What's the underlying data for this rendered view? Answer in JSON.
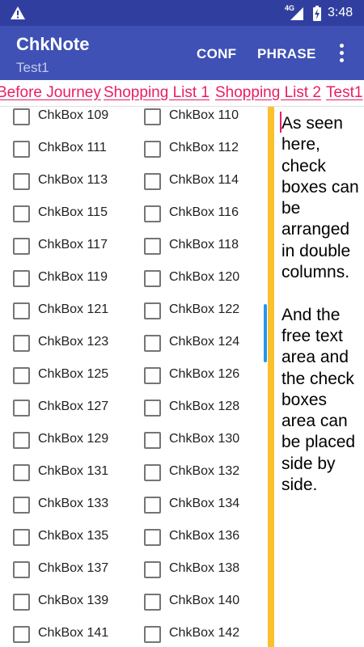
{
  "status_bar": {
    "network": "4G",
    "time": "3:48",
    "icons": [
      "warning-icon",
      "signal-icon",
      "battery-icon"
    ]
  },
  "app_bar": {
    "title": "ChkNote",
    "subtitle": "Test1",
    "actions": [
      "CONF",
      "PHRASE"
    ],
    "overflow_icon": "more-vert-icon"
  },
  "tabs": [
    "Before Journey",
    "Shopping List 1",
    "Shopping List 2",
    "Test1"
  ],
  "checkboxes": [
    "ChkBox 109",
    "ChkBox 110",
    "ChkBox 111",
    "ChkBox 112",
    "ChkBox 113",
    "ChkBox 114",
    "ChkBox 115",
    "ChkBox 116",
    "ChkBox 117",
    "ChkBox 118",
    "ChkBox 119",
    "ChkBox 120",
    "ChkBox 121",
    "ChkBox 122",
    "ChkBox 123",
    "ChkBox 124",
    "ChkBox 125",
    "ChkBox 126",
    "ChkBox 127",
    "ChkBox 128",
    "ChkBox 129",
    "ChkBox 130",
    "ChkBox 131",
    "ChkBox 132",
    "ChkBox 133",
    "ChkBox 134",
    "ChkBox 135",
    "ChkBox 136",
    "ChkBox 137",
    "ChkBox 138",
    "ChkBox 139",
    "ChkBox 140",
    "ChkBox 141",
    "ChkBox 142"
  ],
  "free_text": "As seen here, check boxes can be arranged in double columns.\n\nAnd the free text area and the check boxes area can be placed side by side.",
  "colors": {
    "status_bar": "#303f9f",
    "app_bar": "#3f51b5",
    "tab_text": "#e91e63",
    "separator": "#fbc02d",
    "scroll_thumb": "#2196f3"
  }
}
